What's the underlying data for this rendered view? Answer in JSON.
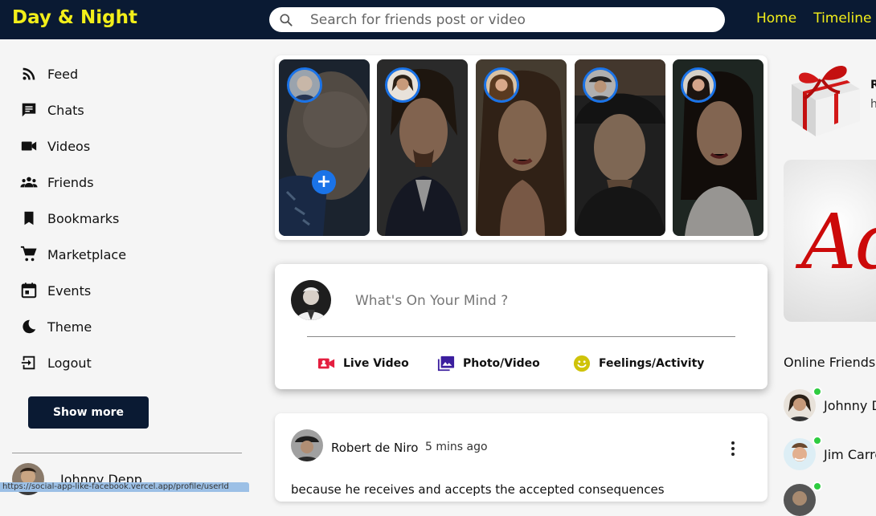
{
  "app": {
    "title": "Day & Night"
  },
  "search": {
    "placeholder": "Search for friends post or video"
  },
  "nav": {
    "links": [
      "Home",
      "Timeline"
    ]
  },
  "sidebar": {
    "items": [
      {
        "label": "Feed",
        "icon": "rss-icon"
      },
      {
        "label": "Chats",
        "icon": "chat-icon"
      },
      {
        "label": "Videos",
        "icon": "video-camera-icon"
      },
      {
        "label": "Friends",
        "icon": "group-icon"
      },
      {
        "label": "Bookmarks",
        "icon": "bookmark-icon"
      },
      {
        "label": "Marketplace",
        "icon": "shopping-cart-icon"
      },
      {
        "label": "Events",
        "icon": "calendar-icon"
      },
      {
        "label": "Theme",
        "icon": "moon-icon"
      },
      {
        "label": "Logout",
        "icon": "logout-icon"
      }
    ],
    "show_more": "Show more",
    "friend": {
      "name": "Johnny Depp"
    }
  },
  "status_url": "https://social-app-like-facebook.vercel.app/profile/userId",
  "share": {
    "placeholder": "What's On Your Mind ?",
    "options": [
      {
        "label": "Live Video",
        "icon": "live-video-icon",
        "color": "#e41e3f"
      },
      {
        "label": "Photo/Video",
        "icon": "photo-library-icon",
        "color": "#3b1e9e"
      },
      {
        "label": "Feelings/Activity",
        "icon": "emoji-icon",
        "color": "#cfc30a"
      }
    ]
  },
  "post": {
    "author": "Robert de Niro",
    "time": "5 mins ago",
    "text": "because he receives and accepts the accepted consequences"
  },
  "rightbar": {
    "gift_title": "R",
    "gift_sub": "h",
    "ad_text": "Adv",
    "online_title": "Online Friends",
    "online": [
      {
        "name": "Johnny Depp"
      },
      {
        "name": "Jim Carrey"
      }
    ]
  },
  "colors": {
    "accent": "#f2ee1a",
    "navy": "#0a1a33",
    "blue": "#1a73e8",
    "online": "#2ecc40"
  }
}
